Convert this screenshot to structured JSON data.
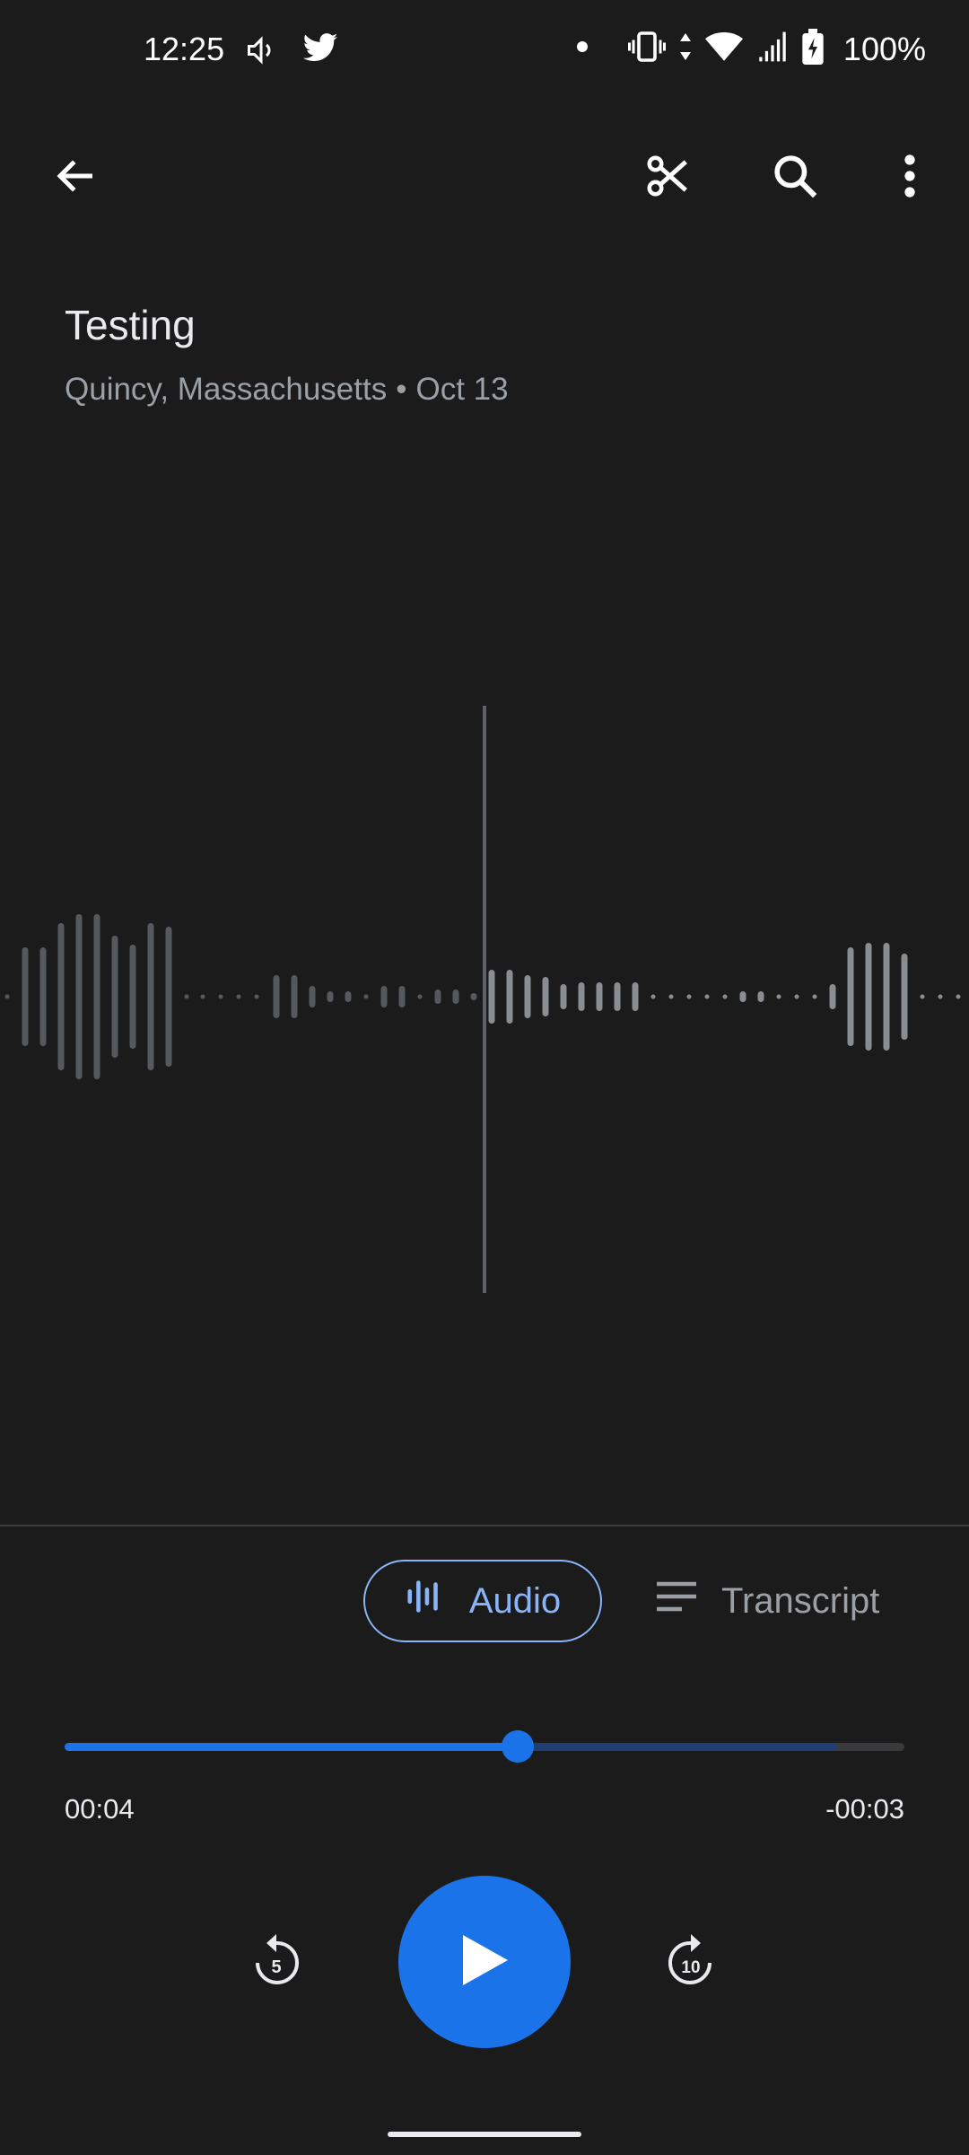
{
  "status_bar": {
    "time": "12:25",
    "battery": "100%",
    "icons": [
      "volume-icon",
      "twitter-icon",
      "notification-dot-icon",
      "vibrate-icon",
      "data-arrows-icon",
      "wifi-icon",
      "signal-icon",
      "battery-charging-icon"
    ]
  },
  "app_bar": {
    "icons": [
      "back-arrow-icon",
      "scissors-icon",
      "search-icon",
      "more-vert-icon"
    ]
  },
  "recording": {
    "title": "Testing",
    "location": "Quincy, Massachusetts",
    "separator": "•",
    "date": "Oct 13"
  },
  "tabs": {
    "audio": "Audio",
    "transcript": "Transcript",
    "selected": "audio"
  },
  "player": {
    "elapsed": "00:04",
    "remaining": "-00:03",
    "progress": 0.54,
    "buffered": 0.92
  },
  "controls": {
    "rewind_seconds": "5",
    "forward_seconds": "10"
  },
  "colors": {
    "background": "#1b1b1c",
    "accent": "#1a73e8",
    "accent_light": "#8ab4f8",
    "secondary_text": "#9aa0a6"
  }
}
